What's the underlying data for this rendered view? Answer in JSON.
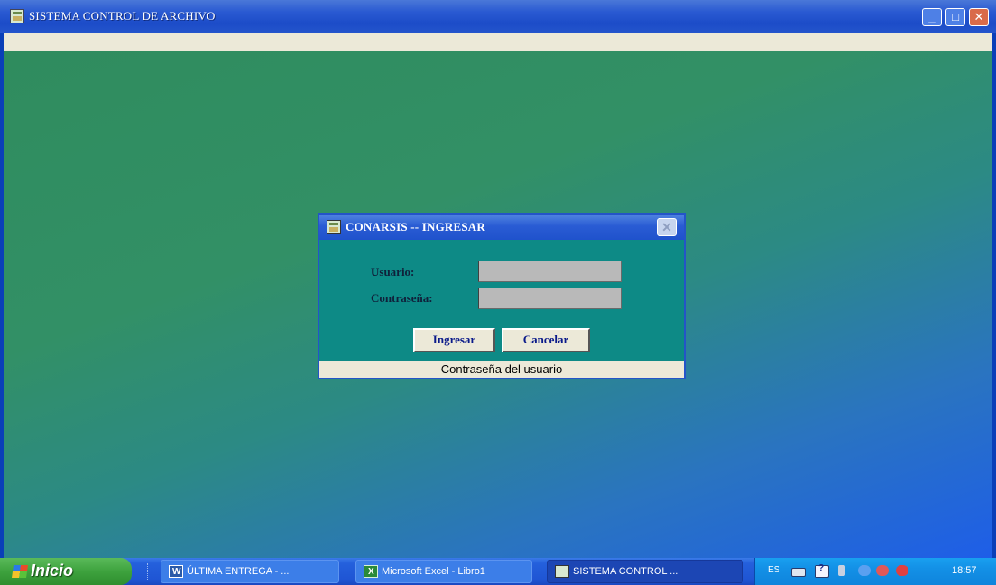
{
  "app": {
    "title": "SISTEMA CONTROL DE ARCHIVO",
    "minimize": "_",
    "maximize": "□",
    "close": "✕"
  },
  "dialog": {
    "title": "CONARSIS  --  INGRESAR",
    "close": "✕",
    "user_label": "Usuario:",
    "password_label": "Contraseña:",
    "user_value": "",
    "password_value": "",
    "ingresar_label": "Ingresar",
    "cancelar_label": "Cancelar",
    "status_text": "Contraseña del usuario"
  },
  "taskbar": {
    "start_label": "Inicio",
    "tasks": [
      {
        "label": "ÚLTIMA ENTREGA - ...",
        "icon": "word-icon"
      },
      {
        "label": "Microsoft Excel - Libro1",
        "icon": "excel-icon"
      },
      {
        "label": "SISTEMA CONTROL ...",
        "icon": "app-icon"
      }
    ],
    "tray": {
      "language": "ES",
      "clock": "18:57"
    }
  },
  "colors": {
    "titlebar": "#2a5ad2",
    "client_green": "#2f8c5e",
    "client_blue": "#1e5ee8",
    "dialog_bg": "#0d8a86",
    "input_bg": "#b9b9b9",
    "button_text": "#0a1a8a"
  }
}
